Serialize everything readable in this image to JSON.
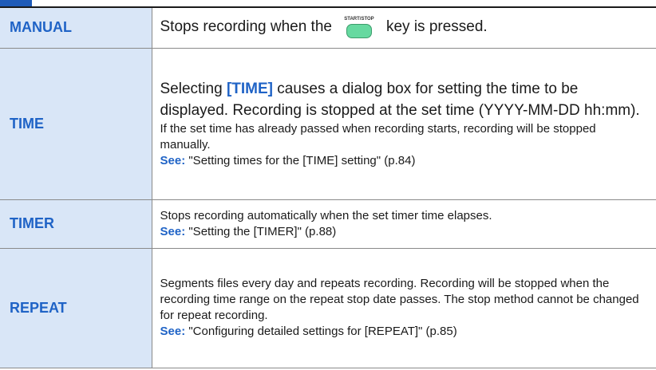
{
  "rows": {
    "manual": {
      "label": "MANUAL",
      "text_before": "Stops recording when the",
      "key_label": "START/STOP",
      "text_after": "key is pressed."
    },
    "time": {
      "label": "TIME",
      "line1_before": "Selecting ",
      "line1_emph": "[TIME]",
      "line1_after": " causes a dialog box for setting the time to be displayed. Recording is stopped at the set time (YYYY-MM-DD hh:mm).",
      "note": "If the set time has already passed when recording starts, recording will be stopped manually.",
      "see_label": "See:",
      "see_text": "\"Setting times for the [TIME] setting\" (p.84)"
    },
    "timer": {
      "label": "TIMER",
      "text": "Stops recording automatically when the set timer time elapses.",
      "see_label": "See:",
      "see_text": "\"Setting the [TIMER]\" (p.88)"
    },
    "repeat": {
      "label": "REPEAT",
      "text": "Segments files every day and repeats recording. Recording will be stopped when the recording time range on the repeat stop date passes. The stop method cannot be changed for repeat recording.",
      "see_label": "See:",
      "see_text": "\"Configuring detailed settings for [REPEAT]\" (p.85)"
    }
  }
}
